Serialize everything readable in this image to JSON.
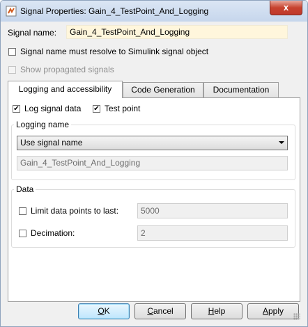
{
  "window": {
    "title": "Signal Properties: Gain_4_TestPoint_And_Logging",
    "close_glyph": "x"
  },
  "signal": {
    "name_label": "Signal name:",
    "name_value": "Gain_4_TestPoint_And_Logging",
    "resolve_label": "Signal name must resolve to Simulink signal object",
    "show_propagated_label": "Show propagated signals"
  },
  "tabs": [
    {
      "label": "Logging and accessibility",
      "active": true
    },
    {
      "label": "Code Generation",
      "active": false
    },
    {
      "label": "Documentation",
      "active": false
    }
  ],
  "logging": {
    "log_signal_label": "Log signal data",
    "log_signal_checked": true,
    "test_point_label": "Test point",
    "test_point_checked": true,
    "check_glyph": "✔",
    "logging_name_title": "Logging name",
    "name_mode_selected": "Use signal name",
    "logging_name_value": "Gain_4_TestPoint_And_Logging"
  },
  "data_group": {
    "title": "Data",
    "limit_label": "Limit data points to last:",
    "limit_value": "5000",
    "decimation_label": "Decimation:",
    "decimation_value": "2"
  },
  "buttons": {
    "ok": {
      "mnemonic": "O",
      "rest": "K"
    },
    "cancel": {
      "mnemonic": "C",
      "rest": "ancel"
    },
    "help": {
      "mnemonic": "H",
      "rest": "elp"
    },
    "apply": {
      "mnemonic": "A",
      "rest": "pply"
    }
  },
  "colors": {
    "title_bar": "#c6d6ec",
    "close_button": "#c7432f",
    "name_field_bg": "#fff6dc",
    "default_button_border": "#3c7fb1"
  }
}
